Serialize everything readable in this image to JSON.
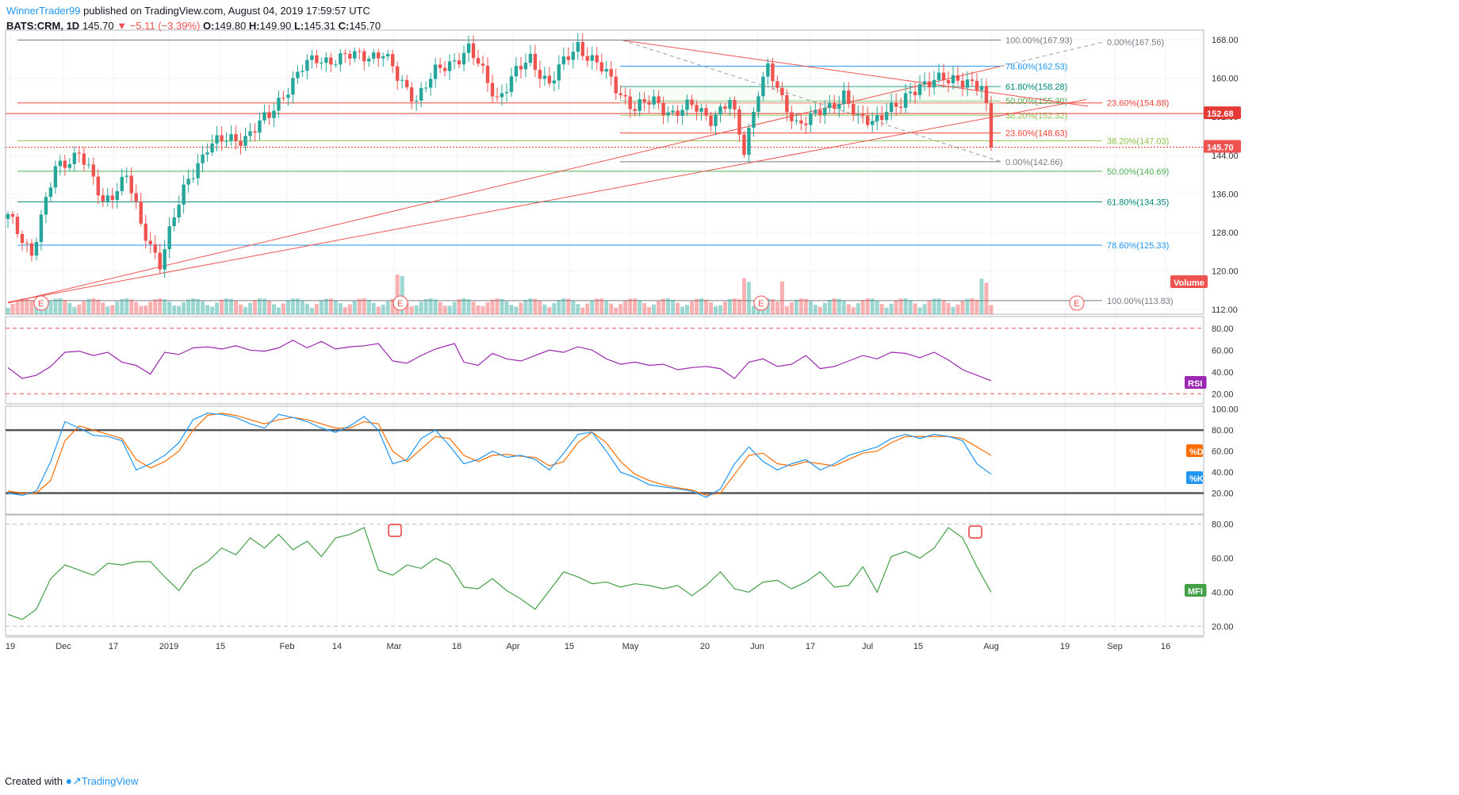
{
  "header": {
    "author": "WinnerTrader99",
    "published": "published on TradingView.com, August 04, 2019 17:59:57 UTC",
    "symbol": "BATS:CRM, 1D",
    "last": "145.70",
    "change": "▼ −5.11 (−3.39%)",
    "o": "149.80",
    "h": "149.90",
    "l": "145.31",
    "c": "145.70"
  },
  "footer": {
    "created": "Created with",
    "brand": "TradingView"
  },
  "colors": {
    "up": "#26a69a",
    "down": "#ef5350",
    "rsi": "#9c27b0",
    "k": "#2196f3",
    "d": "#ff6d00",
    "mfi": "#43a047"
  },
  "chart_data": {
    "type": "candlestick",
    "price_axis": {
      "ticks": [
        "168.00",
        "160.00",
        "152.00",
        "144.00",
        "136.00",
        "128.00",
        "120.00",
        "112.00"
      ],
      "ylim": [
        111,
        170
      ]
    },
    "time_axis": {
      "ticks": [
        "19",
        "Dec",
        "17",
        "2019",
        "15",
        "Feb",
        "14",
        "Mar",
        "18",
        "Apr",
        "15",
        "May",
        "20",
        "Jun",
        "17",
        "Jul",
        "15",
        "Aug",
        "19",
        "Sep",
        "16"
      ]
    },
    "price_labels": {
      "level": "152.68",
      "last": "145.70"
    },
    "fib_levels": {
      "right": [
        "100.00%(113.83)",
        "78.60%(125.33)",
        "61.80%(134.35)",
        "50.00%(140.69)",
        "38.20%(147.03)",
        "23.60%(154.88)"
      ],
      "mid": [
        "100.00%(167.93)",
        "78.60%(162.53)",
        "61.80%(158.28)",
        "50.00%(155.30)",
        "38.20%(152.32)",
        "23.60%(148.63)",
        "0.00%(142.66)"
      ],
      "top": "0.00%(167.56)"
    },
    "series_labels": {
      "volume": "Volume",
      "rsi": "RSI",
      "d": "%D",
      "k": "%K",
      "mfi": "MFI"
    },
    "earnings_marker": "E",
    "rsi_axis": [
      "80.00",
      "60.00",
      "40.00",
      "20.00"
    ],
    "stoch_axis": [
      "100.00",
      "80.00",
      "60.00",
      "40.00",
      "20.00"
    ],
    "mfi_axis": [
      "80.00",
      "60.00",
      "40.00",
      "20.00"
    ],
    "anchors": [
      [
        0,
        131
      ],
      [
        5,
        124
      ],
      [
        10,
        141
      ],
      [
        15,
        145
      ],
      [
        20,
        134
      ],
      [
        25,
        140
      ],
      [
        28,
        129
      ],
      [
        32,
        122
      ],
      [
        35,
        131
      ],
      [
        38,
        139
      ],
      [
        42,
        146
      ],
      [
        46,
        147
      ],
      [
        50,
        148
      ],
      [
        55,
        152
      ],
      [
        58,
        157
      ],
      [
        62,
        162
      ],
      [
        65,
        164
      ],
      [
        70,
        164
      ],
      [
        75,
        165
      ],
      [
        79,
        165
      ],
      [
        82,
        160
      ],
      [
        86,
        156
      ],
      [
        90,
        161
      ],
      [
        94,
        164
      ],
      [
        97,
        166
      ],
      [
        100,
        161
      ],
      [
        103,
        156
      ],
      [
        107,
        161
      ],
      [
        110,
        164
      ],
      [
        114,
        159
      ],
      [
        117,
        163
      ],
      [
        120,
        167
      ],
      [
        124,
        163
      ],
      [
        128,
        158
      ],
      [
        132,
        154
      ],
      [
        136,
        155
      ],
      [
        140,
        153
      ],
      [
        144,
        154
      ],
      [
        148,
        152
      ],
      [
        152,
        155
      ],
      [
        155,
        145
      ],
      [
        158,
        158
      ],
      [
        160,
        162
      ],
      [
        163,
        155
      ],
      [
        166,
        151
      ],
      [
        170,
        152
      ],
      [
        173,
        154
      ],
      [
        176,
        157
      ],
      [
        179,
        151
      ],
      [
        182,
        151
      ],
      [
        185,
        154
      ],
      [
        188,
        154
      ],
      [
        192,
        159
      ],
      [
        195,
        160
      ],
      [
        198,
        159
      ],
      [
        202,
        160
      ],
      [
        205,
        158
      ],
      [
        206,
        153
      ],
      [
        207,
        145.7
      ]
    ],
    "rsi": [
      [
        0,
        44
      ],
      [
        3,
        34
      ],
      [
        6,
        37
      ],
      [
        9,
        45
      ],
      [
        12,
        58
      ],
      [
        15,
        59
      ],
      [
        18,
        55
      ],
      [
        21,
        58
      ],
      [
        24,
        49
      ],
      [
        27,
        46
      ],
      [
        30,
        38
      ],
      [
        33,
        58
      ],
      [
        36,
        56
      ],
      [
        39,
        62
      ],
      [
        42,
        63
      ],
      [
        45,
        61
      ],
      [
        48,
        64
      ],
      [
        51,
        60
      ],
      [
        54,
        59
      ],
      [
        57,
        62
      ],
      [
        60,
        69
      ],
      [
        63,
        62
      ],
      [
        66,
        68
      ],
      [
        69,
        61
      ],
      [
        72,
        63
      ],
      [
        75,
        64
      ],
      [
        78,
        66
      ],
      [
        81,
        50
      ],
      [
        84,
        48
      ],
      [
        87,
        55
      ],
      [
        90,
        61
      ],
      [
        94,
        66
      ],
      [
        96,
        49
      ],
      [
        99,
        46
      ],
      [
        102,
        57
      ],
      [
        105,
        52
      ],
      [
        108,
        50
      ],
      [
        111,
        55
      ],
      [
        114,
        60
      ],
      [
        117,
        58
      ],
      [
        120,
        63
      ],
      [
        123,
        60
      ],
      [
        126,
        52
      ],
      [
        129,
        47
      ],
      [
        132,
        49
      ],
      [
        135,
        46
      ],
      [
        138,
        47
      ],
      [
        141,
        42
      ],
      [
        144,
        44
      ],
      [
        147,
        45
      ],
      [
        150,
        43
      ],
      [
        153,
        34
      ],
      [
        156,
        49
      ],
      [
        159,
        52
      ],
      [
        162,
        45
      ],
      [
        165,
        47
      ],
      [
        168,
        55
      ],
      [
        171,
        43
      ],
      [
        174,
        45
      ],
      [
        177,
        50
      ],
      [
        180,
        55
      ],
      [
        183,
        52
      ],
      [
        186,
        58
      ],
      [
        189,
        57
      ],
      [
        192,
        53
      ],
      [
        195,
        58
      ],
      [
        198,
        51
      ],
      [
        201,
        42
      ],
      [
        204,
        37
      ],
      [
        207,
        32
      ]
    ],
    "stoch_k": [
      [
        0,
        20
      ],
      [
        3,
        18
      ],
      [
        6,
        22
      ],
      [
        9,
        50
      ],
      [
        12,
        88
      ],
      [
        15,
        82
      ],
      [
        18,
        75
      ],
      [
        21,
        74
      ],
      [
        24,
        70
      ],
      [
        27,
        42
      ],
      [
        30,
        48
      ],
      [
        33,
        56
      ],
      [
        36,
        68
      ],
      [
        39,
        90
      ],
      [
        42,
        96
      ],
      [
        45,
        95
      ],
      [
        48,
        92
      ],
      [
        51,
        86
      ],
      [
        54,
        82
      ],
      [
        57,
        95
      ],
      [
        60,
        92
      ],
      [
        63,
        88
      ],
      [
        66,
        82
      ],
      [
        69,
        78
      ],
      [
        72,
        84
      ],
      [
        75,
        93
      ],
      [
        78,
        80
      ],
      [
        81,
        48
      ],
      [
        84,
        52
      ],
      [
        87,
        72
      ],
      [
        90,
        80
      ],
      [
        93,
        65
      ],
      [
        96,
        48
      ],
      [
        99,
        52
      ],
      [
        102,
        60
      ],
      [
        105,
        54
      ],
      [
        108,
        56
      ],
      [
        111,
        52
      ],
      [
        114,
        42
      ],
      [
        117,
        58
      ],
      [
        120,
        76
      ],
      [
        123,
        78
      ],
      [
        126,
        60
      ],
      [
        129,
        40
      ],
      [
        132,
        35
      ],
      [
        135,
        28
      ],
      [
        138,
        26
      ],
      [
        141,
        24
      ],
      [
        144,
        22
      ],
      [
        147,
        16
      ],
      [
        150,
        24
      ],
      [
        153,
        48
      ],
      [
        156,
        64
      ],
      [
        159,
        50
      ],
      [
        162,
        42
      ],
      [
        165,
        48
      ],
      [
        168,
        52
      ],
      [
        171,
        42
      ],
      [
        174,
        48
      ],
      [
        177,
        56
      ],
      [
        180,
        60
      ],
      [
        183,
        64
      ],
      [
        186,
        72
      ],
      [
        189,
        76
      ],
      [
        192,
        72
      ],
      [
        195,
        76
      ],
      [
        198,
        74
      ],
      [
        201,
        70
      ],
      [
        204,
        48
      ],
      [
        207,
        38
      ]
    ],
    "stoch_d": [
      [
        0,
        22
      ],
      [
        3,
        20
      ],
      [
        6,
        20
      ],
      [
        9,
        32
      ],
      [
        12,
        70
      ],
      [
        15,
        84
      ],
      [
        18,
        80
      ],
      [
        21,
        76
      ],
      [
        24,
        72
      ],
      [
        27,
        52
      ],
      [
        30,
        44
      ],
      [
        33,
        50
      ],
      [
        36,
        60
      ],
      [
        39,
        80
      ],
      [
        42,
        94
      ],
      [
        45,
        96
      ],
      [
        48,
        94
      ],
      [
        51,
        90
      ],
      [
        54,
        86
      ],
      [
        57,
        90
      ],
      [
        60,
        92
      ],
      [
        63,
        90
      ],
      [
        66,
        86
      ],
      [
        69,
        82
      ],
      [
        72,
        82
      ],
      [
        75,
        88
      ],
      [
        78,
        86
      ],
      [
        81,
        60
      ],
      [
        84,
        50
      ],
      [
        87,
        62
      ],
      [
        90,
        74
      ],
      [
        93,
        72
      ],
      [
        96,
        56
      ],
      [
        99,
        50
      ],
      [
        102,
        56
      ],
      [
        105,
        57
      ],
      [
        108,
        55
      ],
      [
        111,
        54
      ],
      [
        114,
        46
      ],
      [
        117,
        50
      ],
      [
        120,
        68
      ],
      [
        123,
        78
      ],
      [
        126,
        68
      ],
      [
        129,
        50
      ],
      [
        132,
        38
      ],
      [
        135,
        32
      ],
      [
        138,
        28
      ],
      [
        141,
        25
      ],
      [
        144,
        23
      ],
      [
        147,
        18
      ],
      [
        150,
        20
      ],
      [
        153,
        38
      ],
      [
        156,
        56
      ],
      [
        159,
        58
      ],
      [
        162,
        48
      ],
      [
        165,
        46
      ],
      [
        168,
        50
      ],
      [
        171,
        48
      ],
      [
        174,
        46
      ],
      [
        177,
        52
      ],
      [
        180,
        58
      ],
      [
        183,
        60
      ],
      [
        186,
        68
      ],
      [
        189,
        74
      ],
      [
        192,
        74
      ],
      [
        195,
        74
      ],
      [
        198,
        74
      ],
      [
        201,
        72
      ],
      [
        204,
        64
      ],
      [
        207,
        56
      ]
    ],
    "mfi": [
      [
        0,
        27
      ],
      [
        3,
        24
      ],
      [
        6,
        30
      ],
      [
        9,
        48
      ],
      [
        12,
        56
      ],
      [
        15,
        53
      ],
      [
        18,
        50
      ],
      [
        21,
        57
      ],
      [
        24,
        56
      ],
      [
        27,
        58
      ],
      [
        30,
        58
      ],
      [
        33,
        49
      ],
      [
        36,
        41
      ],
      [
        39,
        53
      ],
      [
        42,
        58
      ],
      [
        45,
        66
      ],
      [
        48,
        62
      ],
      [
        51,
        72
      ],
      [
        54,
        66
      ],
      [
        57,
        74
      ],
      [
        60,
        65
      ],
      [
        63,
        70
      ],
      [
        66,
        61
      ],
      [
        69,
        72
      ],
      [
        72,
        74
      ],
      [
        75,
        78
      ],
      [
        78,
        53
      ],
      [
        81,
        50
      ],
      [
        84,
        56
      ],
      [
        87,
        54
      ],
      [
        90,
        60
      ],
      [
        93,
        56
      ],
      [
        96,
        43
      ],
      [
        99,
        42
      ],
      [
        102,
        48
      ],
      [
        105,
        41
      ],
      [
        108,
        36
      ],
      [
        111,
        30
      ],
      [
        114,
        41
      ],
      [
        117,
        52
      ],
      [
        120,
        49
      ],
      [
        123,
        45
      ],
      [
        126,
        46
      ],
      [
        129,
        43
      ],
      [
        132,
        45
      ],
      [
        135,
        44
      ],
      [
        138,
        42
      ],
      [
        141,
        44
      ],
      [
        144,
        38
      ],
      [
        147,
        44
      ],
      [
        150,
        52
      ],
      [
        153,
        42
      ],
      [
        156,
        40
      ],
      [
        159,
        46
      ],
      [
        162,
        47
      ],
      [
        165,
        42
      ],
      [
        168,
        46
      ],
      [
        171,
        52
      ],
      [
        174,
        43
      ],
      [
        177,
        44
      ],
      [
        180,
        55
      ],
      [
        183,
        40
      ],
      [
        186,
        61
      ],
      [
        189,
        64
      ],
      [
        192,
        60
      ],
      [
        195,
        66
      ],
      [
        198,
        78
      ],
      [
        201,
        72
      ],
      [
        204,
        55
      ],
      [
        207,
        40
      ]
    ]
  }
}
